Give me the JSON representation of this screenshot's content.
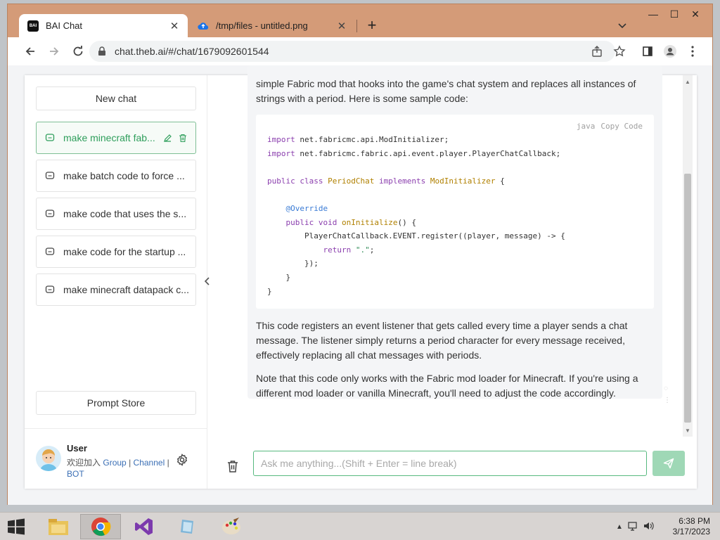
{
  "browser": {
    "tabs": [
      {
        "title": "BAI Chat",
        "favicon": "BAI",
        "active": true
      },
      {
        "title": "/tmp/files - untitled.png",
        "active": false
      }
    ],
    "address": "chat.theb.ai/#/chat/1679092601544"
  },
  "sidebar": {
    "new_chat_label": "New chat",
    "chats": [
      {
        "label": "make minecraft fab...",
        "active": true
      },
      {
        "label": "make batch code to force ...",
        "active": false
      },
      {
        "label": "make code that uses the s...",
        "active": false
      },
      {
        "label": "make code for the startup ...",
        "active": false
      },
      {
        "label": "make minecraft datapack c...",
        "active": false
      }
    ],
    "prompt_store_label": "Prompt Store",
    "user": {
      "name": "User",
      "welcome": "欢迎加入",
      "link_group": "Group",
      "sep1": "|",
      "link_channel": "Channel",
      "sep2": "|",
      "link_bot": "BOT"
    }
  },
  "message": {
    "intro": "simple Fabric mod that hooks into the game's chat system and replaces all instances of strings with a period. Here is some sample code:",
    "code_lang": "java",
    "code_copy_label": "Copy Code",
    "para1": "This code registers an event listener that gets called every time a player sends a chat message. The listener simply returns a period character for every message received, effectively replacing all chat messages with periods.",
    "para2": "Note that this code only works with the Fabric mod loader for Minecraft. If you're using a different mod loader or vanilla Minecraft, you'll need to adjust the code accordingly."
  },
  "composer": {
    "placeholder": "Ask me anything...(Shift + Enter = line break)"
  },
  "taskbar": {
    "time": "6:38 PM",
    "date": "3/17/2023"
  },
  "colors": {
    "accent": "#2e9e5b",
    "send_button": "#9fd8b6",
    "browser_frame": "#d49b78"
  }
}
